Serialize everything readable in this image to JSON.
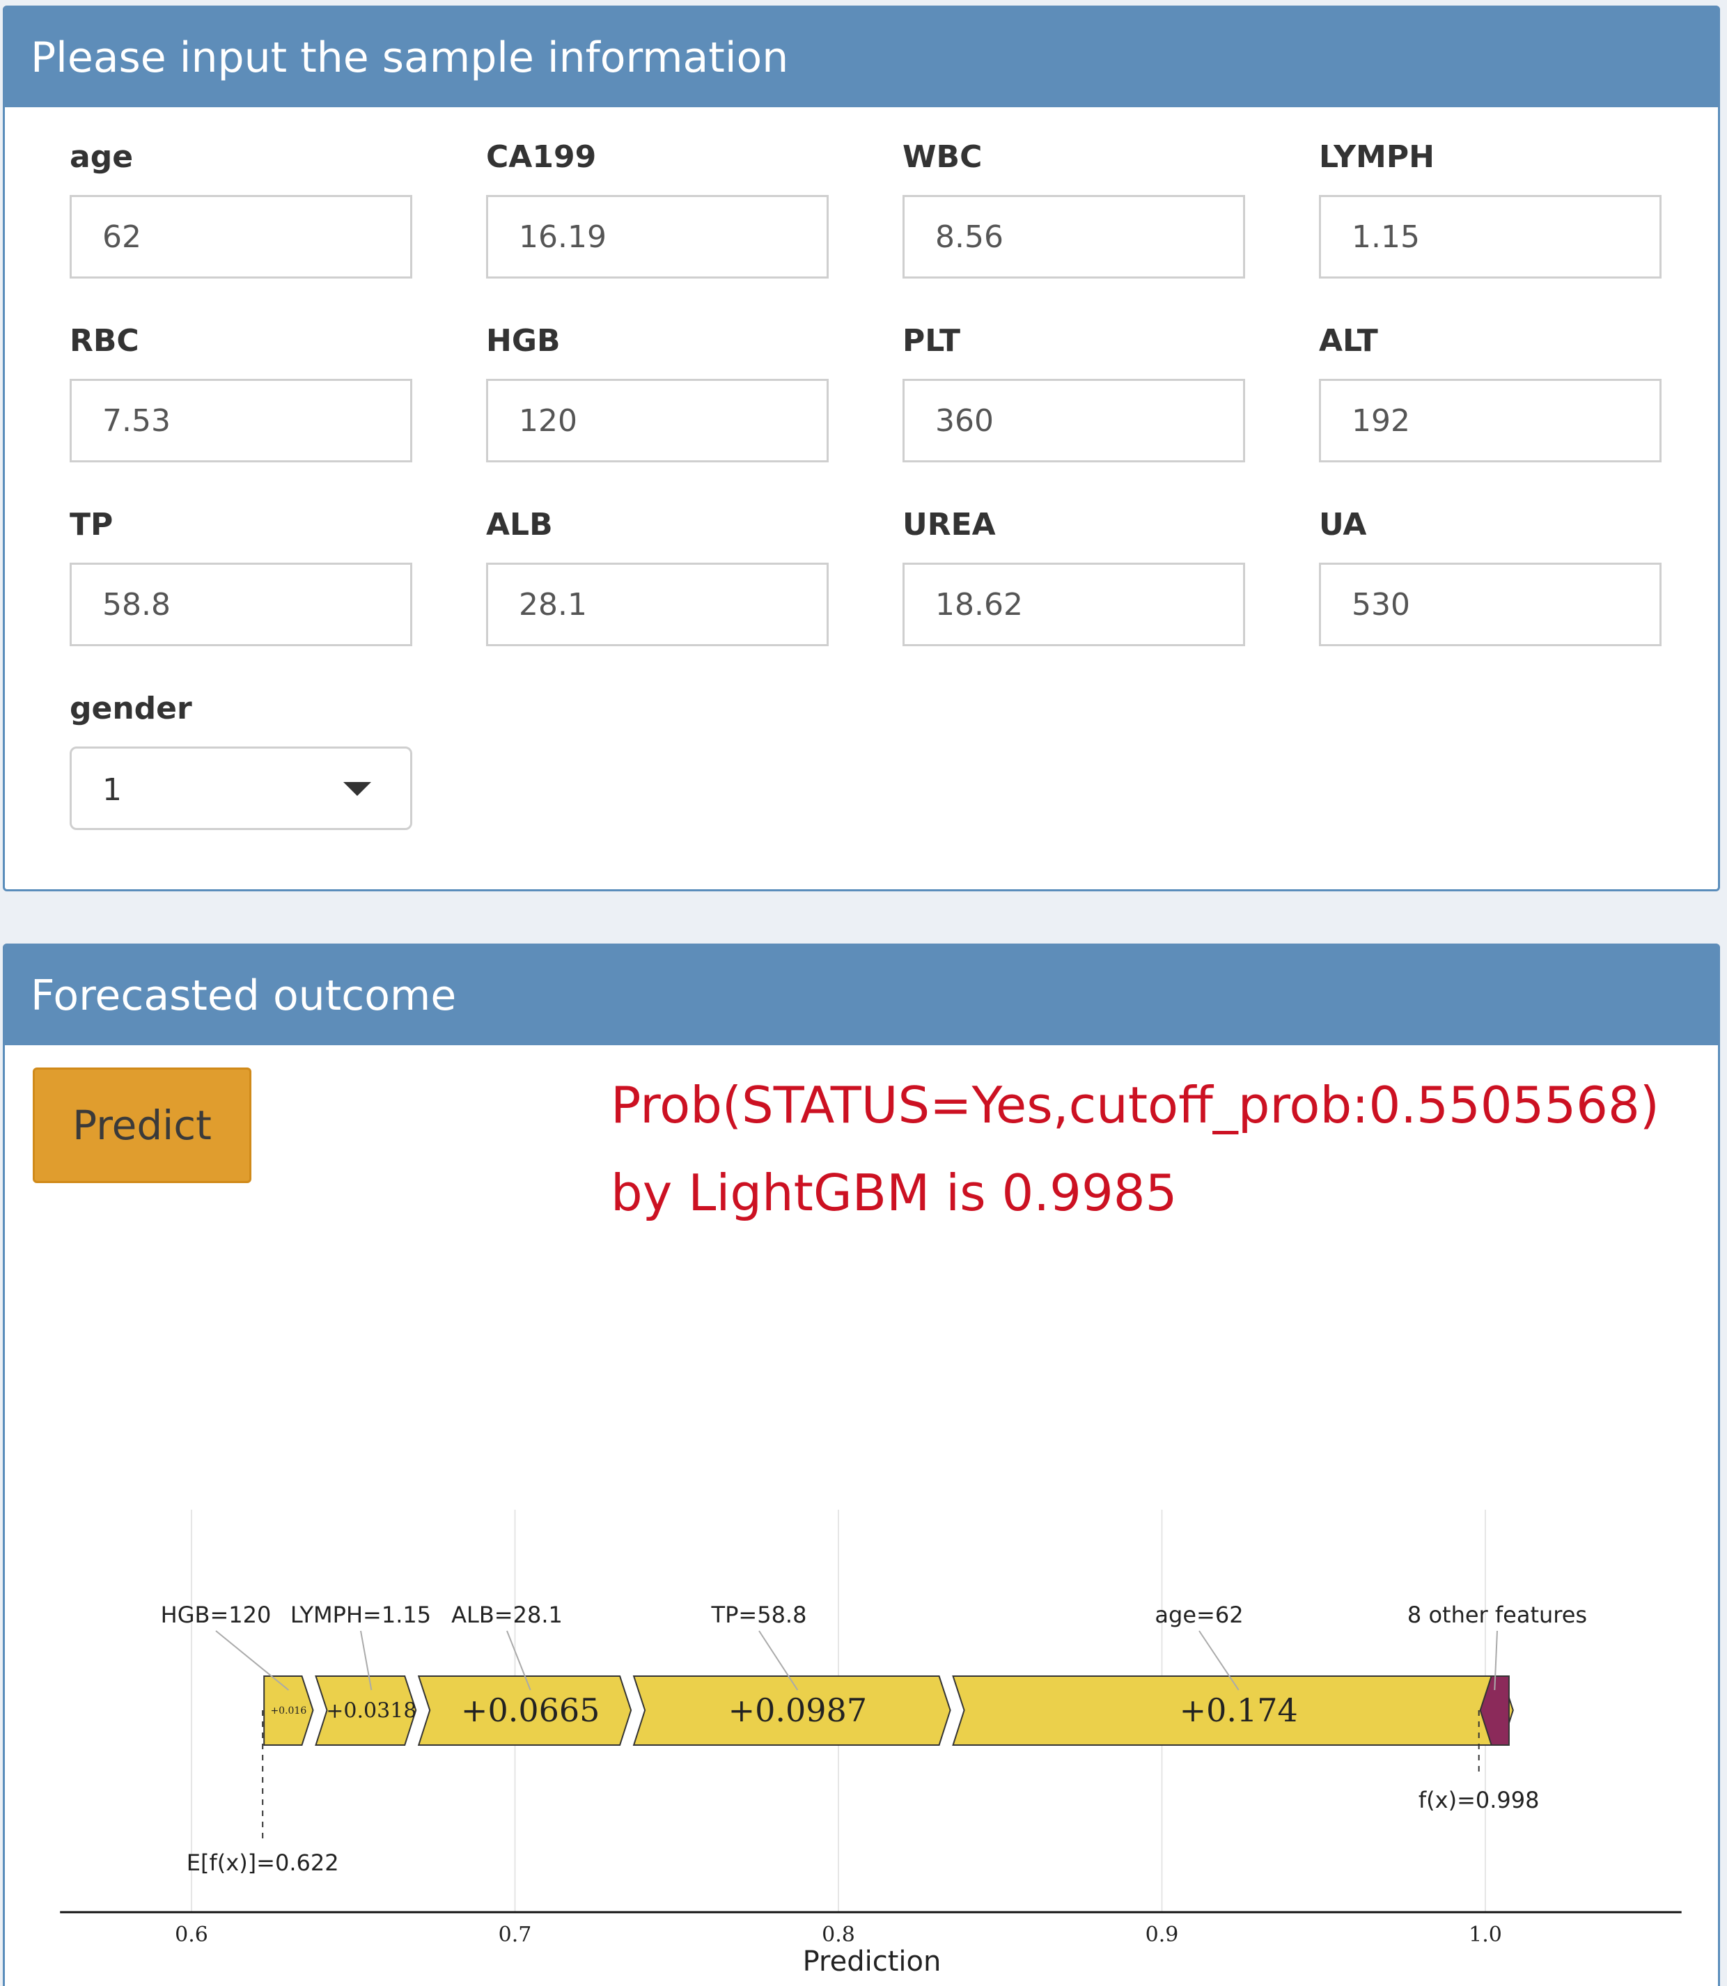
{
  "input_panel": {
    "title": "Please input the sample information",
    "fields": [
      {
        "label": "age",
        "value": "62"
      },
      {
        "label": "CA199",
        "value": "16.19"
      },
      {
        "label": "WBC",
        "value": "8.56"
      },
      {
        "label": "LYMPH",
        "value": "1.15"
      },
      {
        "label": "RBC",
        "value": "7.53"
      },
      {
        "label": "HGB",
        "value": "120"
      },
      {
        "label": "PLT",
        "value": "360"
      },
      {
        "label": "ALT",
        "value": "192"
      },
      {
        "label": "TP",
        "value": "58.8"
      },
      {
        "label": "ALB",
        "value": "28.1"
      },
      {
        "label": "UREA",
        "value": "18.62"
      },
      {
        "label": "UA",
        "value": "530"
      }
    ],
    "gender": {
      "label": "gender",
      "value": "1"
    }
  },
  "output_panel": {
    "title": "Forecasted outcome",
    "predict_label": "Predict",
    "result_line1": "Prob(STATUS=Yes,cutoff_prob:0.5505568)",
    "result_line2": "by LightGBM is 0.9985"
  },
  "chart_data": {
    "type": "force",
    "xlabel": "Prediction",
    "xlim": [
      0.56,
      1.06
    ],
    "ticks": [
      {
        "value": 0.6,
        "label": "0.6"
      },
      {
        "value": 0.7,
        "label": "0.7"
      },
      {
        "value": 0.8,
        "label": "0.8"
      },
      {
        "value": 0.9,
        "label": "0.9"
      },
      {
        "value": 1.0,
        "label": "1.0"
      }
    ],
    "base_value": 0.622,
    "base_label": "E[f(x)]=0.622",
    "output_value": 0.998,
    "output_label": "f(x)=0.998",
    "contributions": [
      {
        "feature": "HGB=120",
        "value": 0.016,
        "label": "+0.016"
      },
      {
        "feature": "LYMPH=1.15",
        "value": 0.0318,
        "label": "+0.0318"
      },
      {
        "feature": "ALB=28.1",
        "value": 0.0665,
        "label": "+0.0665"
      },
      {
        "feature": "TP=58.8",
        "value": 0.0987,
        "label": "+0.0987"
      },
      {
        "feature": "age=62",
        "value": 0.174,
        "label": "+0.174"
      },
      {
        "feature": "8 other features",
        "value": -0.0093,
        "label": ""
      }
    ],
    "grid": true,
    "colors": {
      "positive": "#ebd04b",
      "negative": "#8b2a5a",
      "outline": "#333333"
    }
  }
}
